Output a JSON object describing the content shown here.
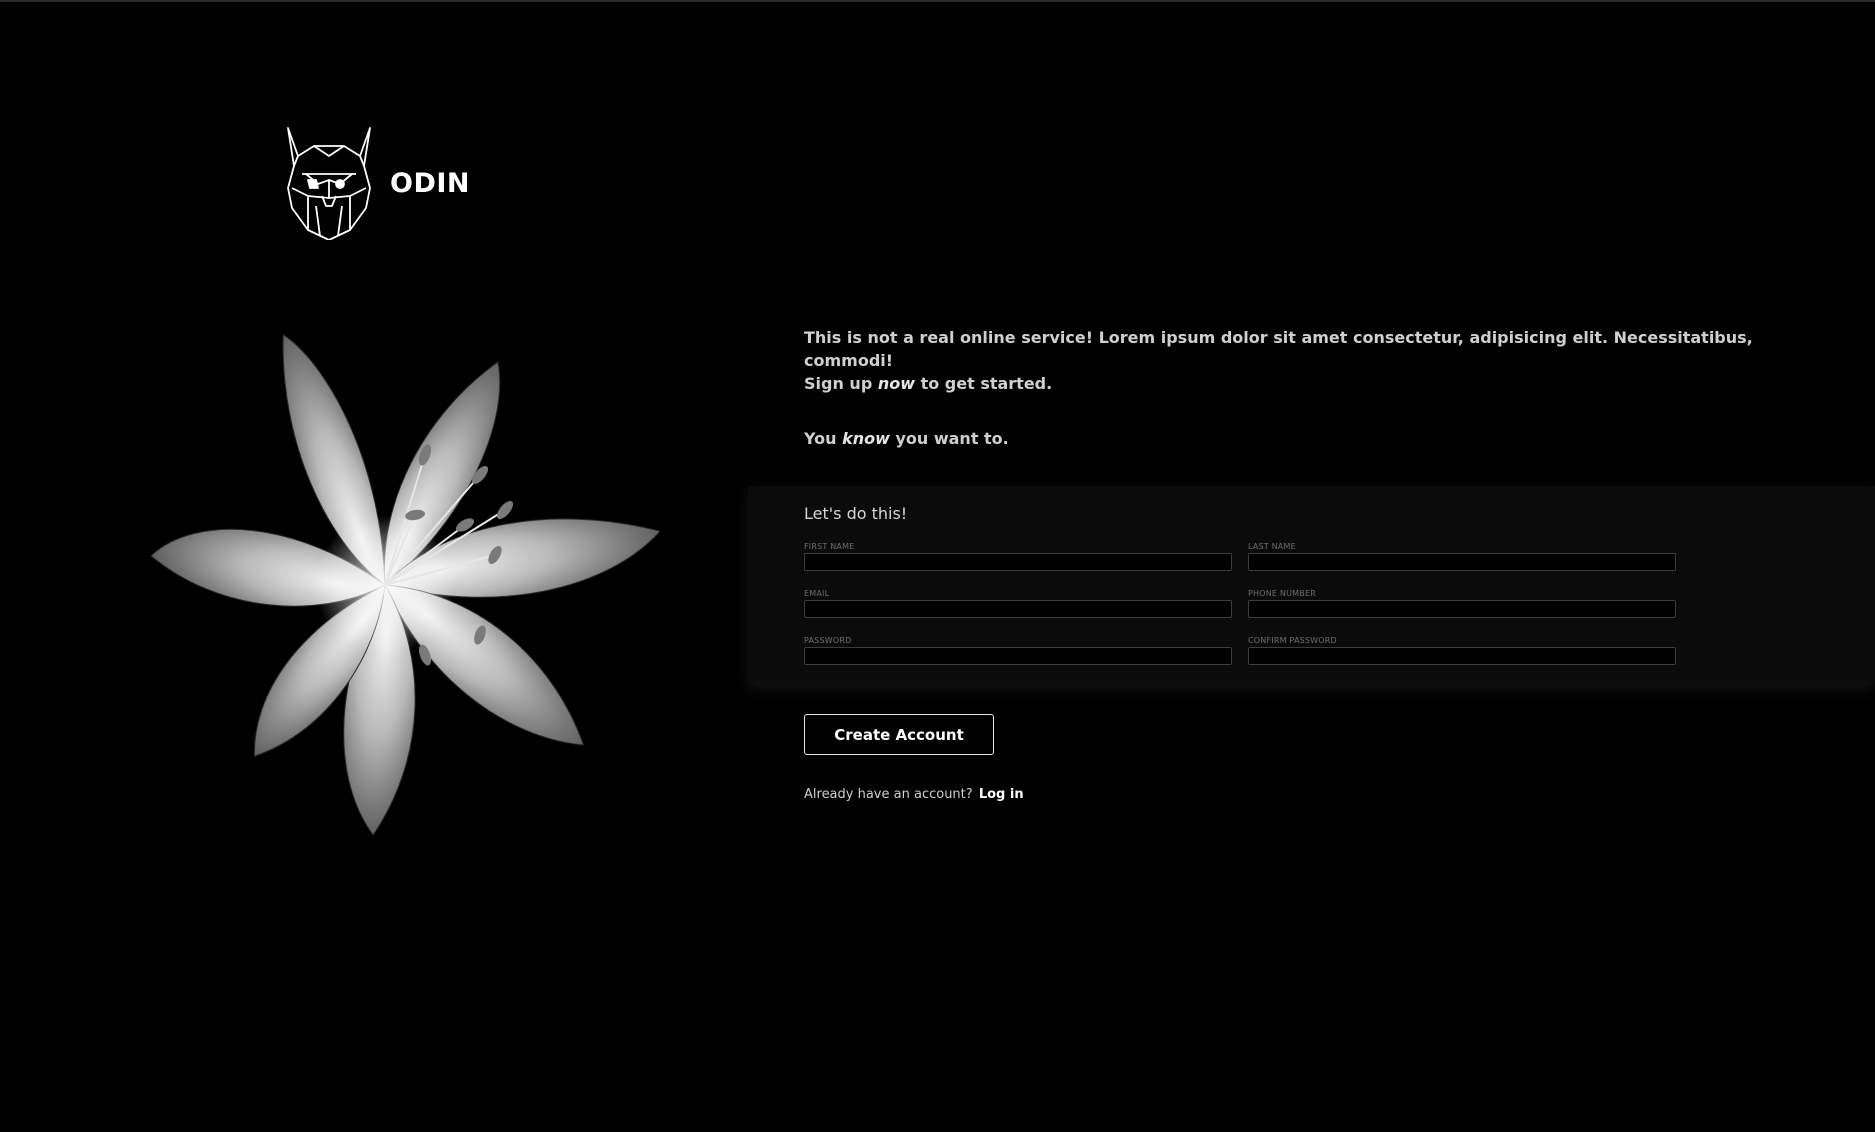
{
  "brand": {
    "name": "ODIN"
  },
  "intro": {
    "line1": "This is not a real online service! Lorem ipsum dolor sit amet consectetur, adipisicing elit. Necessitatibus, commodi!",
    "line2_pre": "Sign up ",
    "line2_em": "now",
    "line2_post": " to get started.",
    "line3_pre": "You ",
    "line3_em": "know",
    "line3_post": " you want to."
  },
  "form": {
    "title": "Let's do this!",
    "fields": [
      {
        "label": "FIRST NAME",
        "value": ""
      },
      {
        "label": "LAST NAME",
        "value": ""
      },
      {
        "label": "EMAIL",
        "value": ""
      },
      {
        "label": "PHONE NUMBER",
        "value": ""
      },
      {
        "label": "PASSWORD",
        "value": ""
      },
      {
        "label": "CONFIRM PASSWORD",
        "value": ""
      }
    ]
  },
  "actions": {
    "create_account": "Create Account",
    "login_prompt": "Already have an account?",
    "login_link": "Log in"
  },
  "colors": {
    "background": "#000000",
    "text": "#cfcfcf",
    "panel": "#0b0b0b",
    "accent": "#ffffff"
  },
  "icons": {
    "logo": "viking-helmet-logo",
    "hero": "lily-flower-image"
  }
}
